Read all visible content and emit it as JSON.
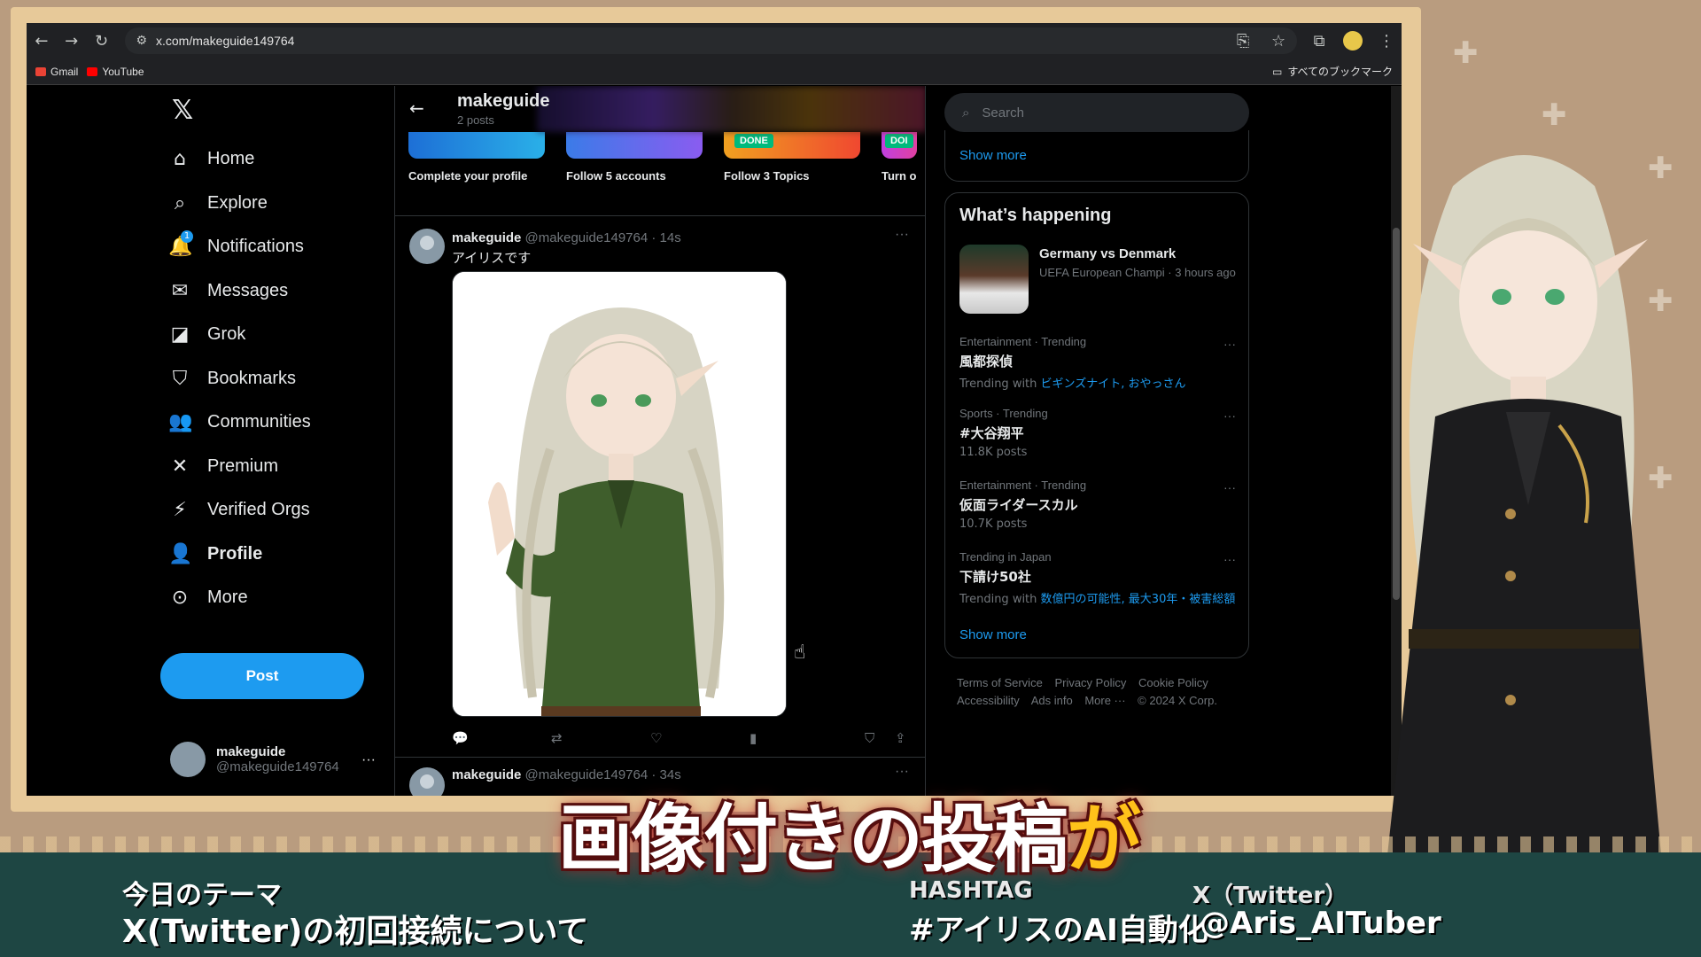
{
  "browser": {
    "url": "x.com/makeguide149764",
    "bookmarks": [
      {
        "label": "Gmail",
        "color": "#ea4335"
      },
      {
        "label": "YouTube",
        "color": "#ff0000"
      }
    ],
    "all_bookmarks_label": "すべてのブックマーク"
  },
  "nav": {
    "logo": "𝕏",
    "items": [
      {
        "label": "Home",
        "icon": "home-icon",
        "glyph": "⌂"
      },
      {
        "label": "Explore",
        "icon": "search-icon",
        "glyph": "⌕"
      },
      {
        "label": "Notifications",
        "icon": "bell-icon",
        "glyph": "🔔",
        "badge": "1"
      },
      {
        "label": "Messages",
        "icon": "mail-icon",
        "glyph": "✉"
      },
      {
        "label": "Grok",
        "icon": "grok-icon",
        "glyph": "◪"
      },
      {
        "label": "Bookmarks",
        "icon": "bookmark-icon",
        "glyph": "⛉"
      },
      {
        "label": "Communities",
        "icon": "communities-icon",
        "glyph": "👥"
      },
      {
        "label": "Premium",
        "icon": "x-premium-icon",
        "glyph": "✕"
      },
      {
        "label": "Verified Orgs",
        "icon": "lightning-icon",
        "glyph": "⚡"
      },
      {
        "label": "Profile",
        "icon": "person-icon",
        "glyph": "👤"
      },
      {
        "label": "More",
        "icon": "more-circle-icon",
        "glyph": "⊙"
      }
    ],
    "post_button": "Post",
    "account": {
      "name": "makeguide",
      "handle": "@makeguide149764"
    }
  },
  "profile_header": {
    "name": "makeguide",
    "posts": "2 posts"
  },
  "onboarding_cards": [
    {
      "label": "Complete your profile",
      "done": false
    },
    {
      "label": "Follow 5 accounts",
      "done": false
    },
    {
      "label": "Follow 3 Topics",
      "done": true,
      "done_label": "DONE"
    },
    {
      "label": "Turn o",
      "done": true,
      "done_label": "DOI"
    }
  ],
  "tweet": {
    "name": "makeguide",
    "meta": "@makeguide149764 · 14s",
    "text": "アイリスです"
  },
  "tweet2": {
    "name": "makeguide",
    "meta": "@makeguide149764 · 34s"
  },
  "right": {
    "search_placeholder": "Search",
    "show_more": "Show more",
    "whats_happening": "What’s happening",
    "featured": {
      "title": "Germany vs Denmark",
      "meta": "UEFA European Champi · 3 hours ago"
    },
    "trends": [
      {
        "category": "Entertainment · Trending",
        "name": "風都探偵",
        "sub_prefix": "Trending with ",
        "sub_link": "ビギンズナイト, おやっさん"
      },
      {
        "category": "Sports · Trending",
        "name": "#大谷翔平",
        "sub_prefix": "11.8K posts",
        "sub_link": ""
      },
      {
        "category": "Entertainment · Trending",
        "name": "仮面ライダースカル",
        "sub_prefix": "10.7K posts",
        "sub_link": ""
      },
      {
        "category": "Trending in Japan",
        "name": "下請け50社",
        "sub_prefix": "Trending with ",
        "sub_link": "数億円の可能性, 最大30年・被害総額"
      }
    ],
    "footer_line1": [
      "Terms of Service",
      "Privacy Policy",
      "Cookie Policy"
    ],
    "footer_line2": [
      "Accessibility",
      "Ads info",
      "More ···",
      "© 2024 X Corp."
    ]
  },
  "overlay": {
    "caption_main": "画像付きの投稿",
    "caption_highlight": "が",
    "theme_label": "今日のテーマ",
    "theme_title": "X(Twitter)の初回接続について",
    "hashtag_label": "HASHTAG",
    "hashtag_value": "#アイリスのAI自動化",
    "x_label": "X（Twitter）",
    "x_handle": "@Aris_AITuber"
  }
}
